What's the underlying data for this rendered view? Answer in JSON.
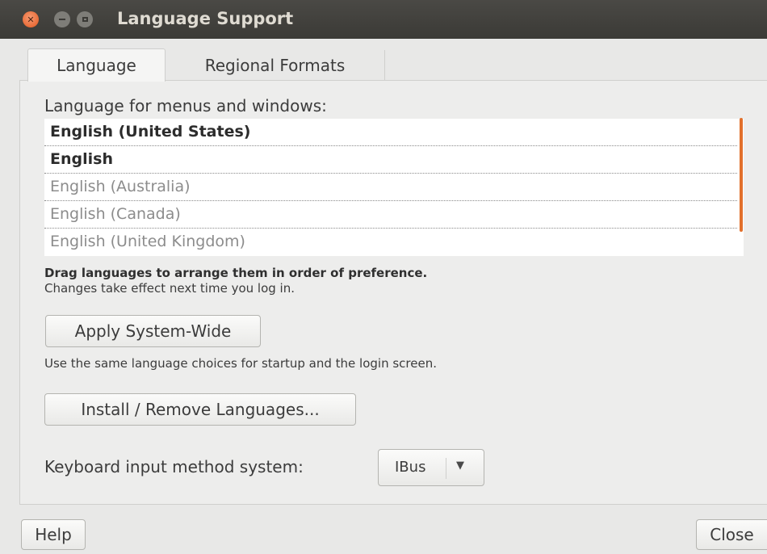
{
  "window": {
    "title": "Language Support",
    "buttons": {
      "close_icon": "close-icon",
      "minimize_icon": "minimize-icon",
      "maximize_icon": "maximize-icon"
    }
  },
  "tabs": [
    {
      "label": "Language",
      "active": true
    },
    {
      "label": "Regional Formats",
      "active": false
    }
  ],
  "language_section": {
    "label": "Language for menus and windows:",
    "items": [
      {
        "label": "English (United States)",
        "enabled": true
      },
      {
        "label": "English",
        "enabled": true
      },
      {
        "label": "English (Australia)",
        "enabled": false
      },
      {
        "label": "English (Canada)",
        "enabled": false
      },
      {
        "label": "English (United Kingdom)",
        "enabled": false
      }
    ],
    "hint_bold": "Drag languages to arrange them in order of preference.",
    "hint": "Changes take effect next time you log in."
  },
  "apply_button": "Apply System-Wide",
  "apply_description": "Use the same language choices for startup and the login screen.",
  "install_button": "Install / Remove Languages...",
  "keyboard": {
    "label": "Keyboard input method system:",
    "selected": "IBus"
  },
  "footer": {
    "help": "Help",
    "close": "Close"
  },
  "colors": {
    "accent": "#e2702c",
    "titlebar": "#3b3a36",
    "close_button": "#e2581f"
  }
}
